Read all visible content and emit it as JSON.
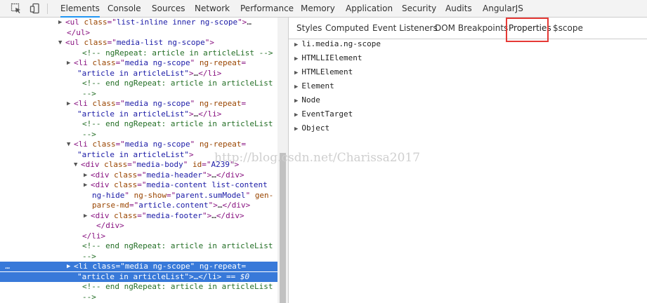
{
  "toolbar": {
    "tabs": [
      "Elements",
      "Console",
      "Sources",
      "Network",
      "Performance",
      "Memory",
      "Application",
      "Security",
      "Audits",
      "AngularJS"
    ],
    "active_tab": "Elements"
  },
  "dom_lines": [
    {
      "tri": "▶",
      "parts": [
        [
          "tag",
          "<ul "
        ],
        [
          "attr",
          "class"
        ],
        [
          "tag",
          "=\""
        ],
        [
          "val",
          "list-inline inner ng-scope"
        ],
        [
          "tag",
          "\">"
        ],
        [
          "txt",
          "…"
        ]
      ]
    },
    {
      "tri": "",
      "parts": [
        [
          "tag",
          "</ul>"
        ]
      ]
    },
    {
      "tri": "▼",
      "parts": [
        [
          "tag",
          "<ul "
        ],
        [
          "attr",
          "class"
        ],
        [
          "tag",
          "=\""
        ],
        [
          "val",
          "media-list ng-scope"
        ],
        [
          "tag",
          "\">"
        ]
      ]
    },
    {
      "tri": "",
      "parts": [
        [
          "cmt",
          "<!-- ngRepeat: article in articleList -->"
        ]
      ]
    },
    {
      "tri": "▶",
      "parts": [
        [
          "tag",
          "<li "
        ],
        [
          "attr",
          "class"
        ],
        [
          "tag",
          "=\""
        ],
        [
          "val",
          "media ng-scope"
        ],
        [
          "tag",
          "\" "
        ],
        [
          "attr",
          "ng-repeat"
        ],
        [
          "tag",
          "="
        ]
      ]
    },
    {
      "tri": "",
      "parts": [
        [
          "val",
          "\"article in articleList\""
        ],
        [
          "tag",
          ">"
        ],
        [
          "txt",
          "…"
        ],
        [
          "tag",
          "</li>"
        ]
      ]
    },
    {
      "tri": "",
      "parts": [
        [
          "cmt",
          "<!-- end ngRepeat: article in articleList"
        ]
      ]
    },
    {
      "tri": "",
      "parts": [
        [
          "cmt",
          "-->"
        ]
      ]
    },
    {
      "tri": "▶",
      "parts": [
        [
          "tag",
          "<li "
        ],
        [
          "attr",
          "class"
        ],
        [
          "tag",
          "=\""
        ],
        [
          "val",
          "media ng-scope"
        ],
        [
          "tag",
          "\" "
        ],
        [
          "attr",
          "ng-repeat"
        ],
        [
          "tag",
          "="
        ]
      ]
    },
    {
      "tri": "",
      "parts": [
        [
          "val",
          "\"article in articleList\""
        ],
        [
          "tag",
          ">"
        ],
        [
          "txt",
          "…"
        ],
        [
          "tag",
          "</li>"
        ]
      ]
    },
    {
      "tri": "",
      "parts": [
        [
          "cmt",
          "<!-- end ngRepeat: article in articleList"
        ]
      ]
    },
    {
      "tri": "",
      "parts": [
        [
          "cmt",
          "-->"
        ]
      ]
    },
    {
      "tri": "▼",
      "parts": [
        [
          "tag",
          "<li "
        ],
        [
          "attr",
          "class"
        ],
        [
          "tag",
          "=\""
        ],
        [
          "val",
          "media ng-scope"
        ],
        [
          "tag",
          "\" "
        ],
        [
          "attr",
          "ng-repeat"
        ],
        [
          "tag",
          "="
        ]
      ]
    },
    {
      "tri": "",
      "parts": [
        [
          "val",
          "\"article in articleList\""
        ],
        [
          "tag",
          ">"
        ]
      ]
    },
    {
      "tri": "▼",
      "parts": [
        [
          "tag",
          "<div "
        ],
        [
          "attr",
          "class"
        ],
        [
          "tag",
          "=\""
        ],
        [
          "val",
          "media-body"
        ],
        [
          "tag",
          "\" "
        ],
        [
          "attr",
          "id"
        ],
        [
          "tag",
          "=\""
        ],
        [
          "val",
          "A239"
        ],
        [
          "tag",
          "\">"
        ]
      ]
    },
    {
      "tri": "▶",
      "parts": [
        [
          "tag",
          "<div "
        ],
        [
          "attr",
          "class"
        ],
        [
          "tag",
          "=\""
        ],
        [
          "val",
          "media-header"
        ],
        [
          "tag",
          "\">"
        ],
        [
          "txt",
          "…"
        ],
        [
          "tag",
          "</div>"
        ]
      ]
    },
    {
      "tri": "▶",
      "parts": [
        [
          "tag",
          "<div "
        ],
        [
          "attr",
          "class"
        ],
        [
          "tag",
          "=\""
        ],
        [
          "val",
          "media-content list-content"
        ]
      ]
    },
    {
      "tri": "",
      "parts": [
        [
          "val",
          "ng-hide"
        ],
        [
          "tag",
          "\" "
        ],
        [
          "attr",
          "ng-show"
        ],
        [
          "tag",
          "=\""
        ],
        [
          "val",
          "parent.sumModel"
        ],
        [
          "tag",
          "\" "
        ],
        [
          "attr",
          "gen-"
        ]
      ]
    },
    {
      "tri": "",
      "parts": [
        [
          "attr",
          "parse-md"
        ],
        [
          "tag",
          "=\""
        ],
        [
          "val",
          "article.content"
        ],
        [
          "tag",
          "\">"
        ],
        [
          "txt",
          "…"
        ],
        [
          "tag",
          "</div>"
        ]
      ]
    },
    {
      "tri": "▶",
      "parts": [
        [
          "tag",
          "<div "
        ],
        [
          "attr",
          "class"
        ],
        [
          "tag",
          "=\""
        ],
        [
          "val",
          "media-footer"
        ],
        [
          "tag",
          "\">"
        ],
        [
          "txt",
          "…"
        ],
        [
          "tag",
          "</div>"
        ]
      ]
    },
    {
      "tri": "",
      "parts": [
        [
          "tag",
          "</div>"
        ]
      ]
    },
    {
      "tri": "",
      "parts": [
        [
          "tag",
          "</li>"
        ]
      ]
    },
    {
      "tri": "",
      "parts": [
        [
          "cmt",
          "<!-- end ngRepeat: article in articleList"
        ]
      ]
    },
    {
      "tri": "",
      "parts": [
        [
          "cmt",
          "-->"
        ]
      ]
    },
    {
      "tri": "▶",
      "parts": [
        [
          "tag",
          "<li "
        ],
        [
          "attr",
          "class"
        ],
        [
          "tag",
          "=\""
        ],
        [
          "val",
          "media ng-scope"
        ],
        [
          "tag",
          "\" "
        ],
        [
          "attr",
          "ng-repeat"
        ],
        [
          "tag",
          "="
        ]
      ]
    },
    {
      "tri": "",
      "parts": [
        [
          "val",
          "\"article in articleList\""
        ],
        [
          "tag",
          ">"
        ],
        [
          "txt",
          "…"
        ],
        [
          "tag",
          "</li>"
        ],
        [
          "selmark",
          " == $0"
        ]
      ]
    },
    {
      "tri": "",
      "parts": [
        [
          "cmt",
          "<!-- end ngRepeat: article in articleList"
        ]
      ]
    },
    {
      "tri": "",
      "parts": [
        [
          "cmt",
          "-->"
        ]
      ]
    }
  ],
  "selected_marker": "…",
  "subtabs": [
    "Styles",
    "Computed",
    "Event Listeners",
    "DOM Breakpoints",
    "Properties",
    "$scope"
  ],
  "active_subtab": "Properties",
  "properties": [
    "li.media.ng-scope",
    "HTMLLIElement",
    "HTMLElement",
    "Element",
    "Node",
    "EventTarget",
    "Object"
  ],
  "watermark": "http://blog.csdn.net/Charissa2017",
  "colors": {
    "accent": "#2196f3",
    "selection": "#3879d9",
    "highlight_box": "#e53935"
  }
}
